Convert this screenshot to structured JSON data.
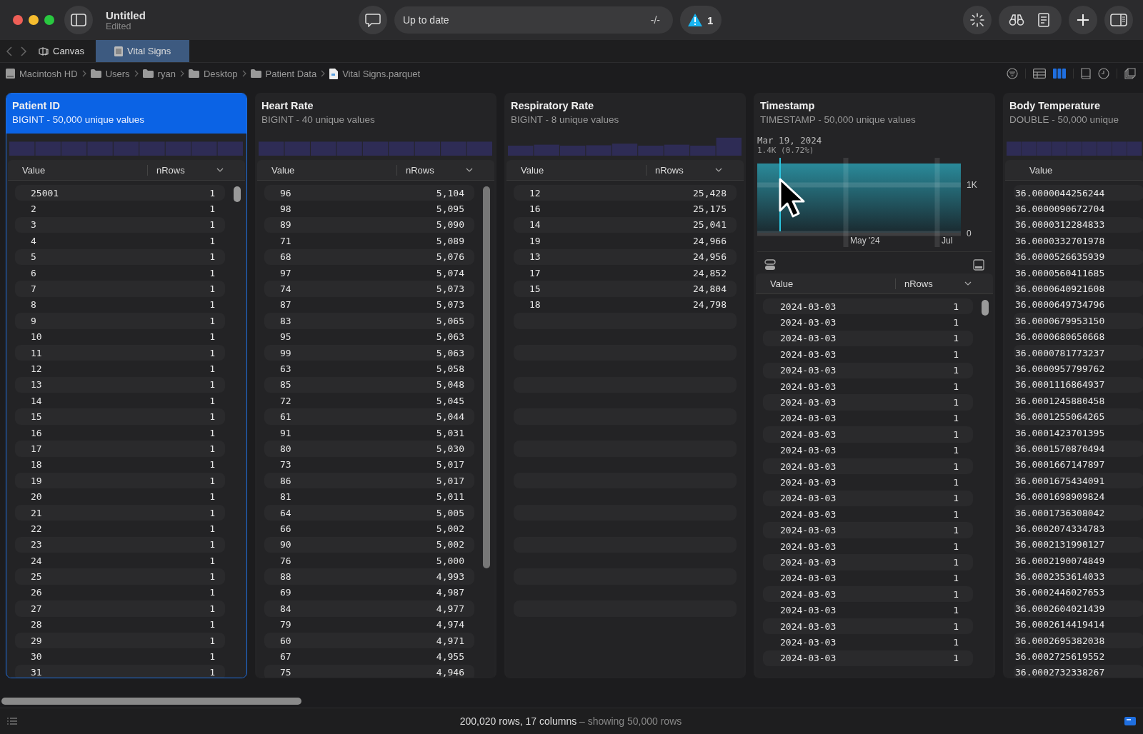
{
  "window": {
    "title": "Untitled",
    "subtitle": "Edited"
  },
  "status_field": {
    "text": "Up to date",
    "shortcut": "-/-"
  },
  "warnings": {
    "count": "1"
  },
  "tabs": [
    {
      "label": "Canvas",
      "selected": false
    },
    {
      "label": "Vital Signs",
      "selected": true
    }
  ],
  "breadcrumb": [
    {
      "label": "Macintosh HD",
      "kind": "disk"
    },
    {
      "label": "Users",
      "kind": "folder"
    },
    {
      "label": "ryan",
      "kind": "folder"
    },
    {
      "label": "Desktop",
      "kind": "folder"
    },
    {
      "label": "Patient Data",
      "kind": "folder"
    },
    {
      "label": "Vital Signs.parquet",
      "kind": "file"
    }
  ],
  "view_modes": [
    {
      "kind": "table",
      "selected": false
    },
    {
      "kind": "columns",
      "selected": true
    }
  ],
  "columns": [
    {
      "kind": "numeric",
      "name": "Patient ID",
      "type_info": "BIGINT - 50,000 unique values",
      "selected": true,
      "headers": [
        "Value",
        "nRows"
      ],
      "rows": [
        {
          "value": "25001",
          "count": "1"
        },
        {
          "value": "2",
          "count": "1"
        },
        {
          "value": "3",
          "count": "1"
        },
        {
          "value": "4",
          "count": "1"
        },
        {
          "value": "5",
          "count": "1"
        },
        {
          "value": "6",
          "count": "1"
        },
        {
          "value": "7",
          "count": "1"
        },
        {
          "value": "8",
          "count": "1"
        },
        {
          "value": "9",
          "count": "1"
        },
        {
          "value": "10",
          "count": "1"
        },
        {
          "value": "11",
          "count": "1"
        },
        {
          "value": "12",
          "count": "1"
        },
        {
          "value": "13",
          "count": "1"
        },
        {
          "value": "14",
          "count": "1"
        },
        {
          "value": "15",
          "count": "1"
        },
        {
          "value": "16",
          "count": "1"
        },
        {
          "value": "17",
          "count": "1"
        },
        {
          "value": "18",
          "count": "1"
        },
        {
          "value": "19",
          "count": "1"
        },
        {
          "value": "20",
          "count": "1"
        },
        {
          "value": "21",
          "count": "1"
        },
        {
          "value": "22",
          "count": "1"
        },
        {
          "value": "23",
          "count": "1"
        },
        {
          "value": "24",
          "count": "1"
        },
        {
          "value": "25",
          "count": "1"
        },
        {
          "value": "26",
          "count": "1"
        },
        {
          "value": "27",
          "count": "1"
        },
        {
          "value": "28",
          "count": "1"
        },
        {
          "value": "29",
          "count": "1"
        },
        {
          "value": "30",
          "count": "1"
        },
        {
          "value": "31",
          "count": "1"
        }
      ]
    },
    {
      "kind": "numeric",
      "name": "Heart Rate",
      "type_info": "BIGINT - 40 unique values",
      "selected": false,
      "headers": [
        "Value",
        "nRows"
      ],
      "rows": [
        {
          "value": "96",
          "count": "5,104"
        },
        {
          "value": "98",
          "count": "5,095"
        },
        {
          "value": "89",
          "count": "5,090"
        },
        {
          "value": "71",
          "count": "5,089"
        },
        {
          "value": "68",
          "count": "5,076"
        },
        {
          "value": "97",
          "count": "5,074"
        },
        {
          "value": "74",
          "count": "5,073"
        },
        {
          "value": "87",
          "count": "5,073"
        },
        {
          "value": "83",
          "count": "5,065"
        },
        {
          "value": "95",
          "count": "5,063"
        },
        {
          "value": "99",
          "count": "5,063"
        },
        {
          "value": "63",
          "count": "5,058"
        },
        {
          "value": "85",
          "count": "5,048"
        },
        {
          "value": "72",
          "count": "5,045"
        },
        {
          "value": "61",
          "count": "5,044"
        },
        {
          "value": "91",
          "count": "5,031"
        },
        {
          "value": "80",
          "count": "5,030"
        },
        {
          "value": "73",
          "count": "5,017"
        },
        {
          "value": "86",
          "count": "5,017"
        },
        {
          "value": "81",
          "count": "5,011"
        },
        {
          "value": "64",
          "count": "5,005"
        },
        {
          "value": "66",
          "count": "5,002"
        },
        {
          "value": "90",
          "count": "5,002"
        },
        {
          "value": "76",
          "count": "5,000"
        },
        {
          "value": "88",
          "count": "4,993"
        },
        {
          "value": "69",
          "count": "4,987"
        },
        {
          "value": "84",
          "count": "4,977"
        },
        {
          "value": "79",
          "count": "4,974"
        },
        {
          "value": "60",
          "count": "4,971"
        },
        {
          "value": "67",
          "count": "4,955"
        },
        {
          "value": "75",
          "count": "4,946"
        }
      ]
    },
    {
      "kind": "numeric",
      "name": "Respiratory Rate",
      "type_info": "BIGINT - 8 unique values",
      "selected": false,
      "headers": [
        "Value",
        "nRows"
      ],
      "rows": [
        {
          "value": "12",
          "count": "25,428"
        },
        {
          "value": "16",
          "count": "25,175"
        },
        {
          "value": "14",
          "count": "25,041"
        },
        {
          "value": "19",
          "count": "24,966"
        },
        {
          "value": "13",
          "count": "24,956"
        },
        {
          "value": "17",
          "count": "24,852"
        },
        {
          "value": "15",
          "count": "24,804"
        },
        {
          "value": "18",
          "count": "24,798"
        }
      ]
    },
    {
      "kind": "timestamp",
      "name": "Timestamp",
      "type_info": "TIMESTAMP - 50,000 unique values",
      "selected": false,
      "headers": [
        "Value",
        "nRows"
      ],
      "hover": {
        "date": "Mar 19, 2024",
        "count": "1.4K (0.72%)"
      },
      "histogram": {
        "y_labels": [
          "1K",
          "0"
        ],
        "x_labels": [
          "May '24",
          "Jul"
        ]
      },
      "rows": [
        {
          "value": "2024-03-03",
          "count": "1"
        },
        {
          "value": "2024-03-03",
          "count": "1"
        },
        {
          "value": "2024-03-03",
          "count": "1"
        },
        {
          "value": "2024-03-03",
          "count": "1"
        },
        {
          "value": "2024-03-03",
          "count": "1"
        },
        {
          "value": "2024-03-03",
          "count": "1"
        },
        {
          "value": "2024-03-03",
          "count": "1"
        },
        {
          "value": "2024-03-03",
          "count": "1"
        },
        {
          "value": "2024-03-03",
          "count": "1"
        },
        {
          "value": "2024-03-03",
          "count": "1"
        },
        {
          "value": "2024-03-03",
          "count": "1"
        },
        {
          "value": "2024-03-03",
          "count": "1"
        },
        {
          "value": "2024-03-03",
          "count": "1"
        },
        {
          "value": "2024-03-03",
          "count": "1"
        },
        {
          "value": "2024-03-03",
          "count": "1"
        },
        {
          "value": "2024-03-03",
          "count": "1"
        },
        {
          "value": "2024-03-03",
          "count": "1"
        },
        {
          "value": "2024-03-03",
          "count": "1"
        },
        {
          "value": "2024-03-03",
          "count": "1"
        },
        {
          "value": "2024-03-03",
          "count": "1"
        },
        {
          "value": "2024-03-03",
          "count": "1"
        },
        {
          "value": "2024-03-03",
          "count": "1"
        },
        {
          "value": "2024-03-03",
          "count": "1"
        }
      ]
    },
    {
      "kind": "wide",
      "name": "Body Temperature",
      "type_info": "DOUBLE - 50,000 unique",
      "selected": false,
      "headers": [
        "Value"
      ],
      "rows": [
        {
          "value": "36.0000044256244"
        },
        {
          "value": "36.0000090672704"
        },
        {
          "value": "36.0000312284833"
        },
        {
          "value": "36.0000332701978"
        },
        {
          "value": "36.0000526635939"
        },
        {
          "value": "36.0000560411685"
        },
        {
          "value": "36.0000640921608"
        },
        {
          "value": "36.0000649734796"
        },
        {
          "value": "36.0000679953150"
        },
        {
          "value": "36.0000680650668"
        },
        {
          "value": "36.0000781773237"
        },
        {
          "value": "36.0000957799762"
        },
        {
          "value": "36.0001116864937"
        },
        {
          "value": "36.0001245880458"
        },
        {
          "value": "36.0001255064265"
        },
        {
          "value": "36.0001423701395"
        },
        {
          "value": "36.0001570870494"
        },
        {
          "value": "36.0001667147897"
        },
        {
          "value": "36.0001675434091"
        },
        {
          "value": "36.0001698909824"
        },
        {
          "value": "36.0001736308042"
        },
        {
          "value": "36.0002074334783"
        },
        {
          "value": "36.0002131990127"
        },
        {
          "value": "36.0002190074849"
        },
        {
          "value": "36.0002353614033"
        },
        {
          "value": "36.0002446027653"
        },
        {
          "value": "36.0002604021439"
        },
        {
          "value": "36.0002614419414"
        },
        {
          "value": "36.0002695382038"
        },
        {
          "value": "36.0002725619552"
        },
        {
          "value": "36.0002732338267"
        }
      ]
    }
  ],
  "status_bar": {
    "summary": "200,020 rows, 17 columns",
    "detail": "– showing 50,000 rows"
  }
}
